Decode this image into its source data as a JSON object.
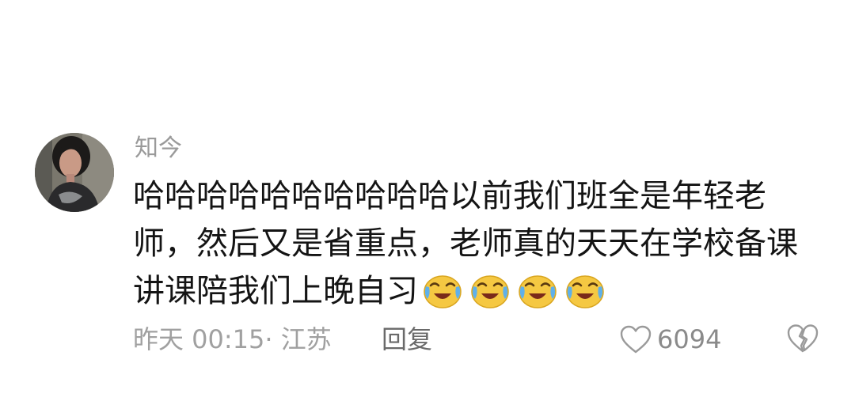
{
  "comment": {
    "username": "知今",
    "text": "哈哈哈哈哈哈哈哈哈哈以前我们班全是年轻老师，然后又是省重点，老师真的天天在学校备课讲课陪我们上晚自习",
    "emojis": [
      "crying-laughing-emoji",
      "crying-laughing-emoji",
      "crying-laughing-emoji",
      "crying-laughing-emoji"
    ],
    "meta": "昨天 00:15· 江苏",
    "reply_label": "回复",
    "like_count": "6094",
    "icons": {
      "like": "heart-outline-icon",
      "dislike": "broken-heart-icon"
    },
    "colors": {
      "text": "#141414",
      "muted": "#9a9a9a",
      "emoji_face": "#f5c842"
    }
  }
}
